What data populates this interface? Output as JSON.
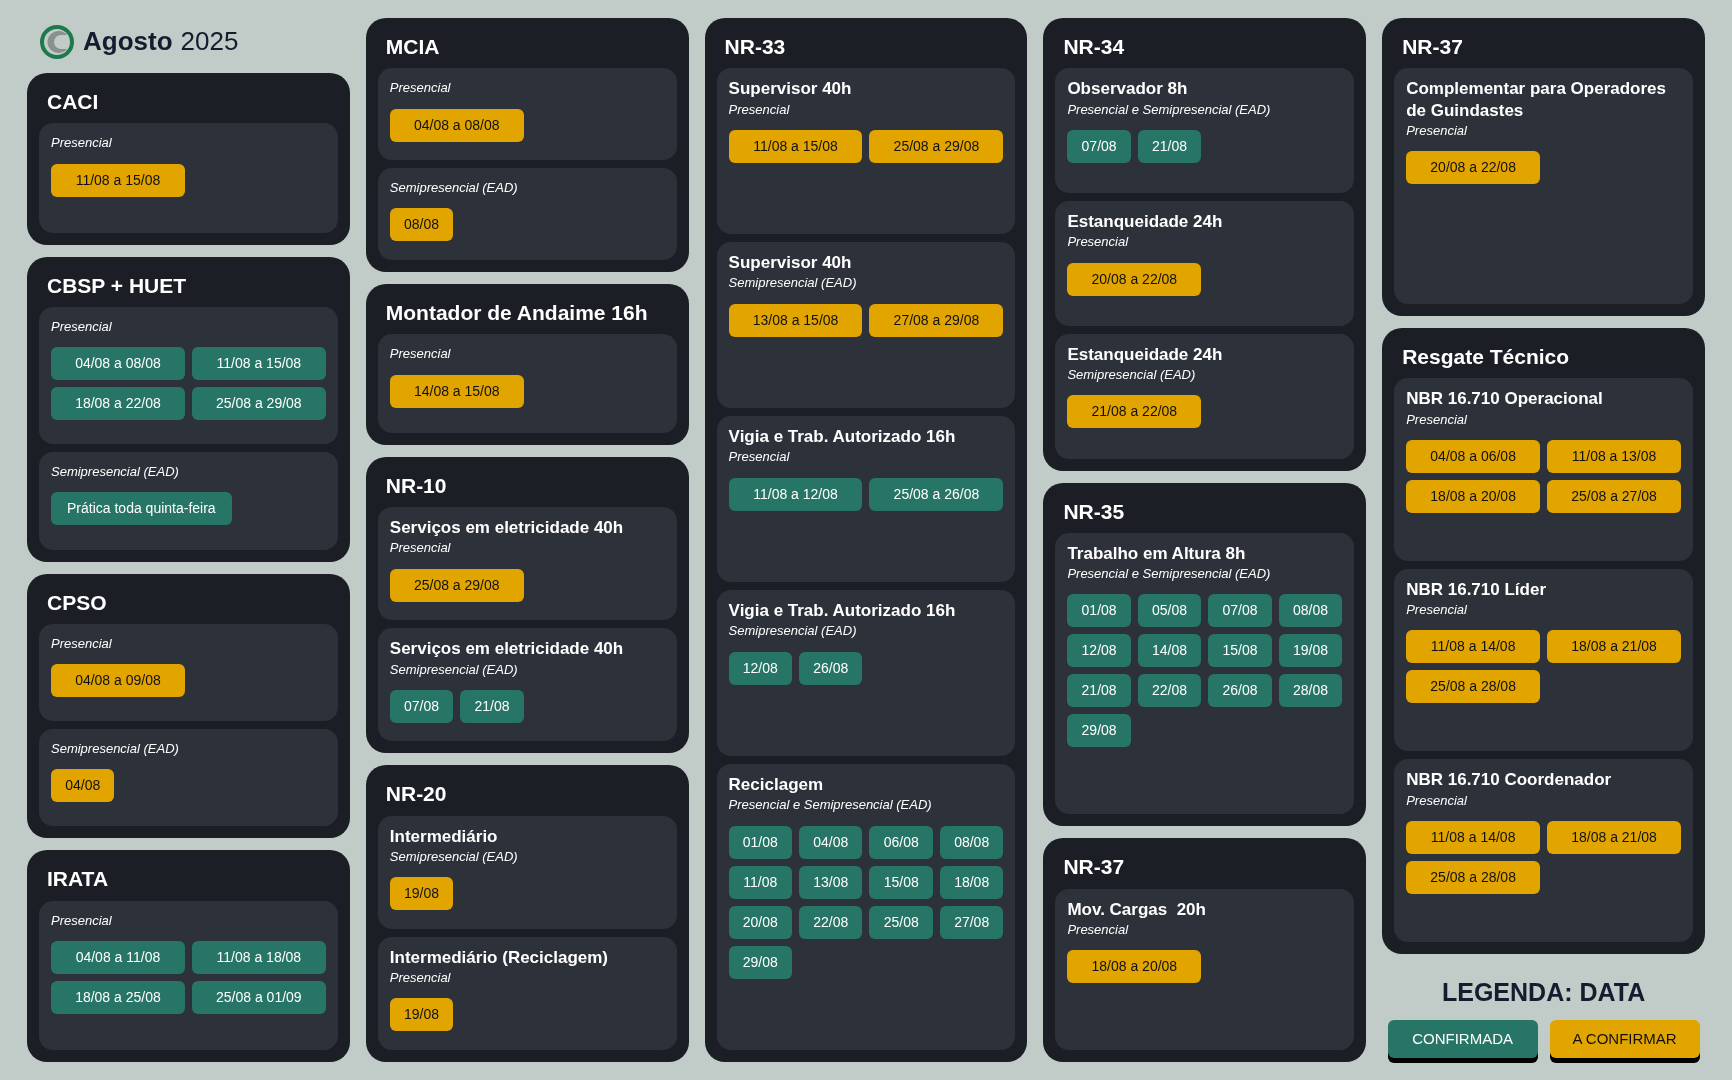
{
  "header": {
    "month": "Agosto",
    "year": "2025"
  },
  "columns": [
    [
      {
        "title": "CACI",
        "sections": [
          {
            "mode": "Presencial",
            "dates": [
              {
                "text": "11/08 a 15/08",
                "kind": "pending"
              }
            ]
          }
        ]
      },
      {
        "title": "CBSP + HUET",
        "sections": [
          {
            "mode": "Presencial",
            "dates": [
              {
                "text": "04/08 a 08/08",
                "kind": "confirmed"
              },
              {
                "text": "11/08 a 15/08",
                "kind": "confirmed"
              },
              {
                "text": "18/08 a 22/08",
                "kind": "confirmed"
              },
              {
                "text": "25/08 a 29/08",
                "kind": "confirmed"
              }
            ]
          },
          {
            "mode": "Semipresencial (EAD)",
            "dates": [
              {
                "text": "Prática toda quinta-feira",
                "kind": "confirmed"
              }
            ]
          }
        ]
      },
      {
        "title": "CPSO",
        "sections": [
          {
            "mode": "Presencial",
            "dates": [
              {
                "text": "04/08 a 09/08",
                "kind": "pending"
              }
            ]
          },
          {
            "mode": "Semipresencial (EAD)",
            "dates": [
              {
                "text": "04/08",
                "kind": "pending"
              }
            ]
          }
        ]
      },
      {
        "title": "IRATA",
        "sections": [
          {
            "mode": "Presencial",
            "dates": [
              {
                "text": "04/08 a 11/08",
                "kind": "confirmed"
              },
              {
                "text": "11/08 a 18/08",
                "kind": "confirmed"
              },
              {
                "text": "18/08 a 25/08",
                "kind": "confirmed"
              },
              {
                "text": "25/08 a 01/09",
                "kind": "confirmed"
              }
            ]
          }
        ]
      }
    ],
    [
      {
        "title": "MCIA",
        "sections": [
          {
            "mode": "Presencial",
            "dates": [
              {
                "text": "04/08 a 08/08",
                "kind": "pending"
              }
            ]
          },
          {
            "mode": "Semipresencial (EAD)",
            "dates": [
              {
                "text": "08/08",
                "kind": "pending"
              }
            ]
          }
        ]
      },
      {
        "title": "Montador de Andaime 16h",
        "sections": [
          {
            "mode": "Presencial",
            "dates": [
              {
                "text": "14/08 a 15/08",
                "kind": "pending"
              }
            ]
          }
        ]
      },
      {
        "title": "NR-10",
        "sections": [
          {
            "name": "Serviços em eletricidade 40h",
            "mode": "Presencial",
            "dates": [
              {
                "text": "25/08 a 29/08",
                "kind": "pending"
              }
            ]
          },
          {
            "name": "Serviços em eletricidade 40h",
            "mode": "Semipresencial (EAD)",
            "dates": [
              {
                "text": "07/08",
                "kind": "confirmed"
              },
              {
                "text": "21/08",
                "kind": "confirmed"
              }
            ]
          }
        ]
      },
      {
        "title": "NR-20",
        "sections": [
          {
            "name": "Intermediário",
            "mode": "Semipresencial (EAD)",
            "dates": [
              {
                "text": "19/08",
                "kind": "pending"
              }
            ]
          },
          {
            "name": "Intermediário (Reciclagem)",
            "mode": "Presencial",
            "dates": [
              {
                "text": "19/08",
                "kind": "pending"
              }
            ]
          }
        ]
      }
    ],
    [
      {
        "title": "NR-33",
        "sections": [
          {
            "name": "Supervisor 40h",
            "mode": "Presencial",
            "dates": [
              {
                "text": "11/08 a 15/08",
                "kind": "pending"
              },
              {
                "text": "25/08 a 29/08",
                "kind": "pending"
              }
            ]
          },
          {
            "name": "Supervisor 40h",
            "mode": "Semipresencial (EAD)",
            "dates": [
              {
                "text": "13/08 a 15/08",
                "kind": "pending"
              },
              {
                "text": "27/08 a 29/08",
                "kind": "pending"
              }
            ]
          },
          {
            "name": "Vigia e Trab. Autorizado 16h",
            "mode": "Presencial",
            "dates": [
              {
                "text": "11/08 a 12/08",
                "kind": "confirmed"
              },
              {
                "text": "25/08 a 26/08",
                "kind": "confirmed"
              }
            ]
          },
          {
            "name": "Vigia e Trab. Autorizado 16h",
            "mode": "Semipresencial (EAD)",
            "dates": [
              {
                "text": "12/08",
                "kind": "confirmed"
              },
              {
                "text": "26/08",
                "kind": "confirmed"
              }
            ]
          },
          {
            "name": "Reciclagem",
            "mode": "Presencial e Semipresencial (EAD)",
            "dates": [
              {
                "text": "01/08",
                "kind": "confirmed"
              },
              {
                "text": "04/08",
                "kind": "confirmed"
              },
              {
                "text": "06/08",
                "kind": "confirmed"
              },
              {
                "text": "08/08",
                "kind": "confirmed"
              },
              {
                "text": "11/08",
                "kind": "confirmed"
              },
              {
                "text": "13/08",
                "kind": "confirmed"
              },
              {
                "text": "15/08",
                "kind": "confirmed"
              },
              {
                "text": "18/08",
                "kind": "confirmed"
              },
              {
                "text": "20/08",
                "kind": "confirmed"
              },
              {
                "text": "22/08",
                "kind": "confirmed"
              },
              {
                "text": "25/08",
                "kind": "confirmed"
              },
              {
                "text": "27/08",
                "kind": "confirmed"
              },
              {
                "text": "29/08",
                "kind": "confirmed"
              }
            ]
          }
        ]
      }
    ],
    [
      {
        "title": "NR-34",
        "sections": [
          {
            "name": "Observador 8h",
            "mode": "Presencial e Semipresencial (EAD)",
            "dates": [
              {
                "text": "07/08",
                "kind": "confirmed"
              },
              {
                "text": "21/08",
                "kind": "confirmed"
              }
            ]
          },
          {
            "name": "Estanqueidade 24h",
            "mode": "Presencial",
            "dates": [
              {
                "text": "20/08 a 22/08",
                "kind": "pending"
              }
            ]
          },
          {
            "name": "Estanqueidade 24h",
            "mode": "Semipresencial (EAD)",
            "dates": [
              {
                "text": "21/08 a 22/08",
                "kind": "pending"
              }
            ]
          }
        ]
      },
      {
        "title": "NR-35",
        "sections": [
          {
            "name": "Trabalho em Altura 8h",
            "mode": "Presencial e Semipresencial (EAD)",
            "dates": [
              {
                "text": "01/08",
                "kind": "confirmed"
              },
              {
                "text": "05/08",
                "kind": "confirmed"
              },
              {
                "text": "07/08",
                "kind": "confirmed"
              },
              {
                "text": "08/08",
                "kind": "confirmed"
              },
              {
                "text": "12/08",
                "kind": "confirmed"
              },
              {
                "text": "14/08",
                "kind": "confirmed"
              },
              {
                "text": "15/08",
                "kind": "confirmed"
              },
              {
                "text": "19/08",
                "kind": "confirmed"
              },
              {
                "text": "21/08",
                "kind": "confirmed"
              },
              {
                "text": "22/08",
                "kind": "confirmed"
              },
              {
                "text": "26/08",
                "kind": "confirmed"
              },
              {
                "text": "28/08",
                "kind": "confirmed"
              },
              {
                "text": "29/08",
                "kind": "confirmed"
              }
            ]
          }
        ]
      },
      {
        "title": "NR-37",
        "sections": [
          {
            "name": "Mov. Cargas  20h",
            "mode": "Presencial",
            "dates": [
              {
                "text": "18/08 a 20/08",
                "kind": "pending"
              }
            ]
          }
        ]
      }
    ],
    [
      {
        "title": "NR-37",
        "sections": [
          {
            "name": "Complementar para Operadores de Guindastes",
            "mode": "Presencial",
            "dates": [
              {
                "text": "20/08 a 22/08",
                "kind": "pending"
              }
            ]
          }
        ]
      },
      {
        "title": "Resgate Técnico",
        "sections": [
          {
            "name": "NBR 16.710 Operacional",
            "mode": "Presencial",
            "dates": [
              {
                "text": "04/08 a 06/08",
                "kind": "pending"
              },
              {
                "text": "11/08 a 13/08",
                "kind": "pending"
              },
              {
                "text": "18/08 a 20/08",
                "kind": "pending"
              },
              {
                "text": "25/08 a 27/08",
                "kind": "pending"
              }
            ]
          },
          {
            "name": "NBR 16.710 Líder",
            "mode": "Presencial",
            "dates": [
              {
                "text": "11/08 a 14/08",
                "kind": "pending"
              },
              {
                "text": "18/08 a 21/08",
                "kind": "pending"
              },
              {
                "text": "25/08 a 28/08",
                "kind": "pending"
              }
            ]
          },
          {
            "name": "NBR 16.710 Coordenador",
            "mode": "Presencial",
            "dates": [
              {
                "text": "11/08 a 14/08",
                "kind": "pending"
              },
              {
                "text": "18/08 a 21/08",
                "kind": "pending"
              },
              {
                "text": "25/08 a 28/08",
                "kind": "pending"
              }
            ]
          }
        ]
      }
    ]
  ],
  "legend": {
    "title": "LEGENDA: DATA",
    "items": [
      {
        "label": "CONFIRMADA",
        "kind": "confirmed"
      },
      {
        "label": "A CONFIRMAR",
        "kind": "pending"
      }
    ]
  }
}
